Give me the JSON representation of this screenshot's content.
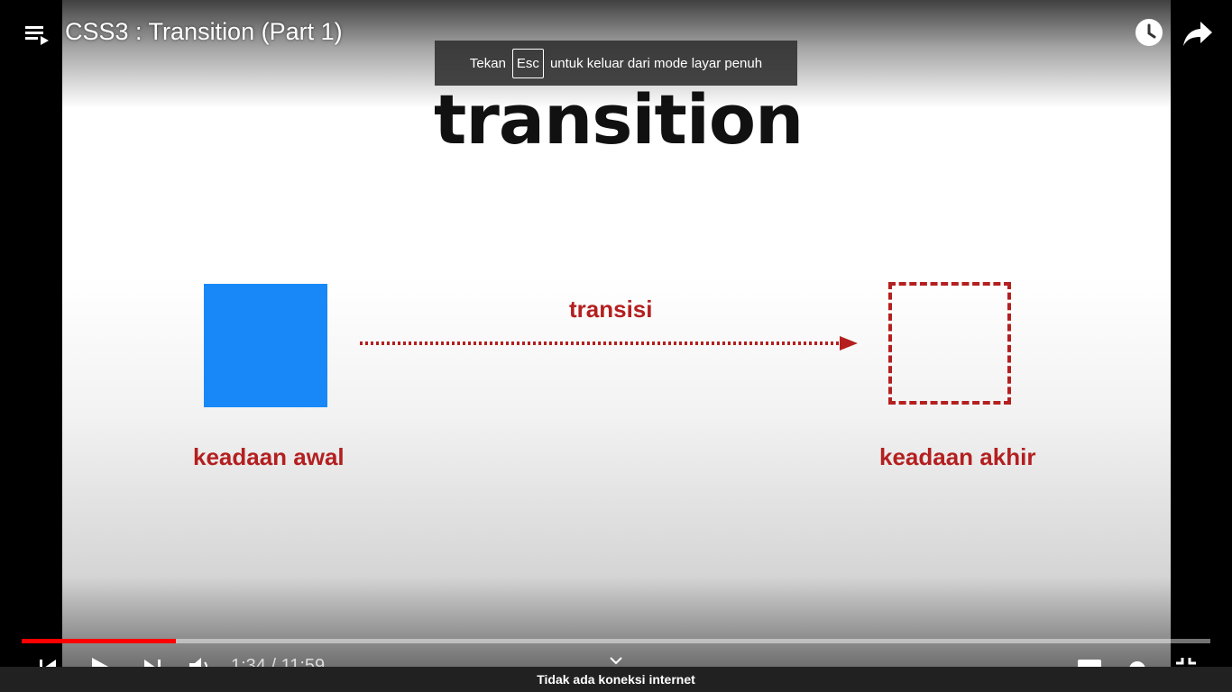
{
  "video": {
    "title": "CSS3 : Transition (Part 1)"
  },
  "slide": {
    "heading": "transition",
    "arrow_label": "transisi",
    "start_label": "keadaan awal",
    "end_label": "keadaan akhir",
    "colors": {
      "start_box": "#1888f8",
      "accent_red": "#b41f1f"
    }
  },
  "toast": {
    "prefix": "Tekan",
    "key": "Esc",
    "suffix": "untuk keluar dari mode layar penuh"
  },
  "player": {
    "time_display": "1:34 / 11:59",
    "progress_fraction": 0.13,
    "progress_color": "#ff0000",
    "icons": [
      "playlist-icon",
      "watch-later-icon",
      "share-icon",
      "previous-icon",
      "play-icon",
      "next-icon",
      "volume-icon",
      "chevron-down-icon",
      "subtitles-icon",
      "settings-icon",
      "fullscreen-exit-icon"
    ]
  },
  "status": {
    "offline_message": "Tidak ada koneksi internet"
  }
}
